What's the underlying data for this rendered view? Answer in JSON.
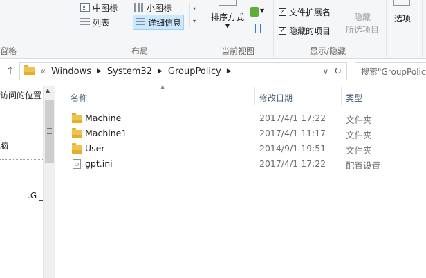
{
  "ribbon": {
    "group_labels": {
      "pane": "窗格",
      "layout": "布局",
      "current_view": "当前视图",
      "show_hide": "显示/隐藏"
    },
    "layout": {
      "medium_icons": "中图标",
      "small_icons": "小图标",
      "list": "列表",
      "details": "详细信息"
    },
    "current_view": {
      "sort_by": "排序方式"
    },
    "show_hide": {
      "file_ext_label": "文件扩展名",
      "file_ext_checked": true,
      "hidden_items_label": "隐藏的项目",
      "hidden_items_checked": true,
      "hide_selected_line1": "隐藏",
      "hide_selected_line2": "所选项目",
      "options": "选项"
    }
  },
  "address": {
    "chevron": "«",
    "crumbs": [
      "Windows",
      "System32",
      "GroupPolicy"
    ],
    "search_placeholder": "搜索\"GroupPolicy\""
  },
  "nav": {
    "items": [
      "访问的位置",
      "脑",
      ".G _"
    ]
  },
  "columns": {
    "name": "名称",
    "modified": "修改日期",
    "type": "类型"
  },
  "files": [
    {
      "name": "Machine",
      "modified": "2017/4/1 17:22",
      "type": "文件夹",
      "icon": "folder-icon"
    },
    {
      "name": "Machine1",
      "modified": "2017/4/1 11:17",
      "type": "文件夹",
      "icon": "folder-icon"
    },
    {
      "name": "User",
      "modified": "2014/9/1 19:51",
      "type": "文件夹",
      "icon": "folder-icon"
    },
    {
      "name": "gpt.ini",
      "modified": "2017/4/1 17:22",
      "type": "配置设置",
      "icon": "settings-file-icon"
    }
  ]
}
